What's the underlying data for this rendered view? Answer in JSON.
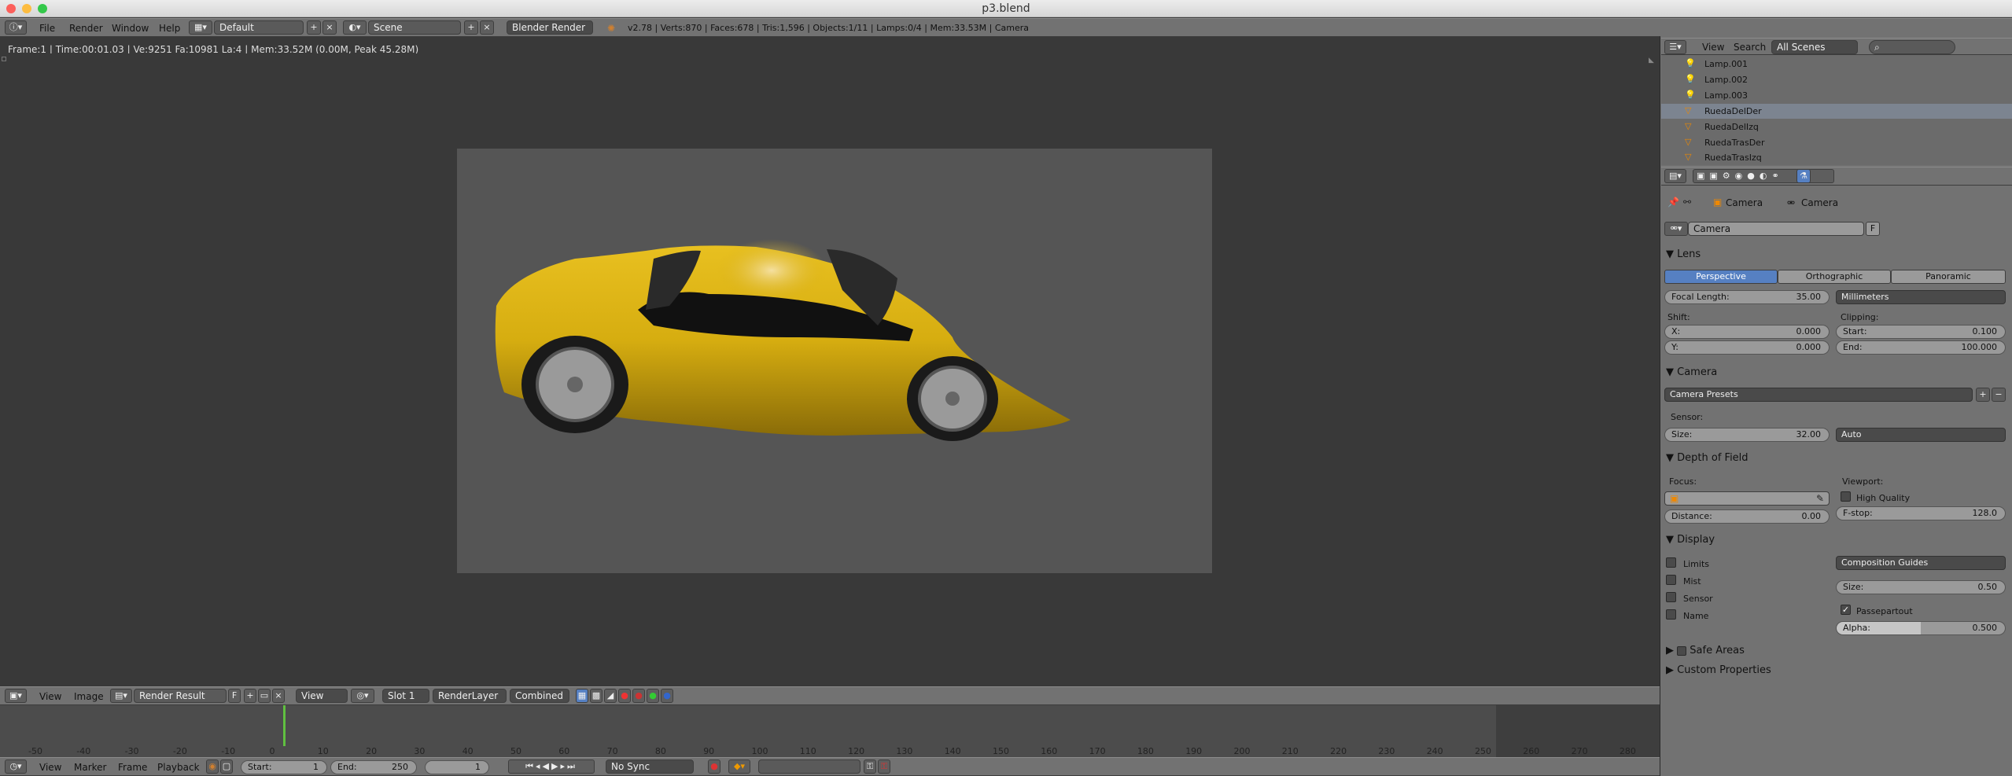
{
  "window": {
    "title": "p3.blend"
  },
  "menu": {
    "items": [
      "File",
      "Render",
      "Window",
      "Help"
    ],
    "layout": "Default",
    "scene": "Scene",
    "engine": "Blender Render",
    "stats": "v2.78 | Verts:870 | Faces:678 | Tris:1,596 | Objects:1/11 | Lamps:0/4 | Mem:33.53M | Camera"
  },
  "info": {
    "text": "Frame:1 | Time:00:01.03 | Ve:9251 Fa:10981 La:4 | Mem:33.52M (0.00M, Peak 45.28M)"
  },
  "image_editor": {
    "view": "View",
    "image": "Image",
    "result": "Render Result",
    "f": "F",
    "view_dd": "View",
    "slot": "Slot 1",
    "layer": "RenderLayer",
    "pass": "Combined"
  },
  "timeline": {
    "ticks": [
      "-50",
      "-40",
      "-30",
      "-20",
      "-10",
      "0",
      "10",
      "20",
      "30",
      "40",
      "50",
      "60",
      "70",
      "80",
      "90",
      "100",
      "110",
      "120",
      "130",
      "140",
      "150",
      "160",
      "170",
      "180",
      "190",
      "200",
      "210",
      "220",
      "230",
      "240",
      "250",
      "260",
      "270",
      "280"
    ],
    "menu": [
      "View",
      "Marker",
      "Frame",
      "Playback"
    ],
    "start_label": "Start:",
    "start": "1",
    "end_label": "End:",
    "end": "250",
    "current": "1",
    "sync": "No Sync"
  },
  "outliner": {
    "view": "View",
    "search": "Search",
    "scenes": "All Scenes",
    "items": [
      "Lamp.001",
      "Lamp.002",
      "Lamp.003",
      "RuedaDelDer",
      "RuedaDelIzq",
      "RuedaTrasDer",
      "RuedaTrasIzq"
    ]
  },
  "properties": {
    "breadcrumb": [
      "Camera",
      "Camera"
    ],
    "datablock": "Camera",
    "datablock_f": "F",
    "lens": {
      "title": "Lens",
      "tabs": [
        "Perspective",
        "Orthographic",
        "Panoramic"
      ],
      "focal_label": "Focal Length:",
      "focal": "35.00",
      "unit": "Millimeters",
      "shift_label": "Shift:",
      "clip_label": "Clipping:",
      "x_label": "X:",
      "x": "0.000",
      "y_label": "Y:",
      "y": "0.000",
      "start_label": "Start:",
      "start": "0.100",
      "end_label": "End:",
      "end": "100.000"
    },
    "camera": {
      "title": "Camera",
      "presets": "Camera Presets",
      "sensor_label": "Sensor:",
      "size_label": "Size:",
      "size": "32.00",
      "fit": "Auto"
    },
    "dof": {
      "title": "Depth of Field",
      "focus_label": "Focus:",
      "viewport_label": "Viewport:",
      "hq": "High Quality",
      "distance_label": "Distance:",
      "distance": "0.00",
      "fstop_label": "F-stop:",
      "fstop": "128.0"
    },
    "display": {
      "title": "Display",
      "checks": [
        "Limits",
        "Mist",
        "Sensor",
        "Name"
      ],
      "guides": "Composition Guides",
      "size_label": "Size:",
      "size": "0.50",
      "passepartout": "Passepartout",
      "alpha_label": "Alpha:",
      "alpha": "0.500"
    },
    "safe_areas": "Safe Areas",
    "custom_props": "Custom Properties"
  },
  "colors": {
    "accent": "#5680c2",
    "frame_marker": "#60c040"
  }
}
